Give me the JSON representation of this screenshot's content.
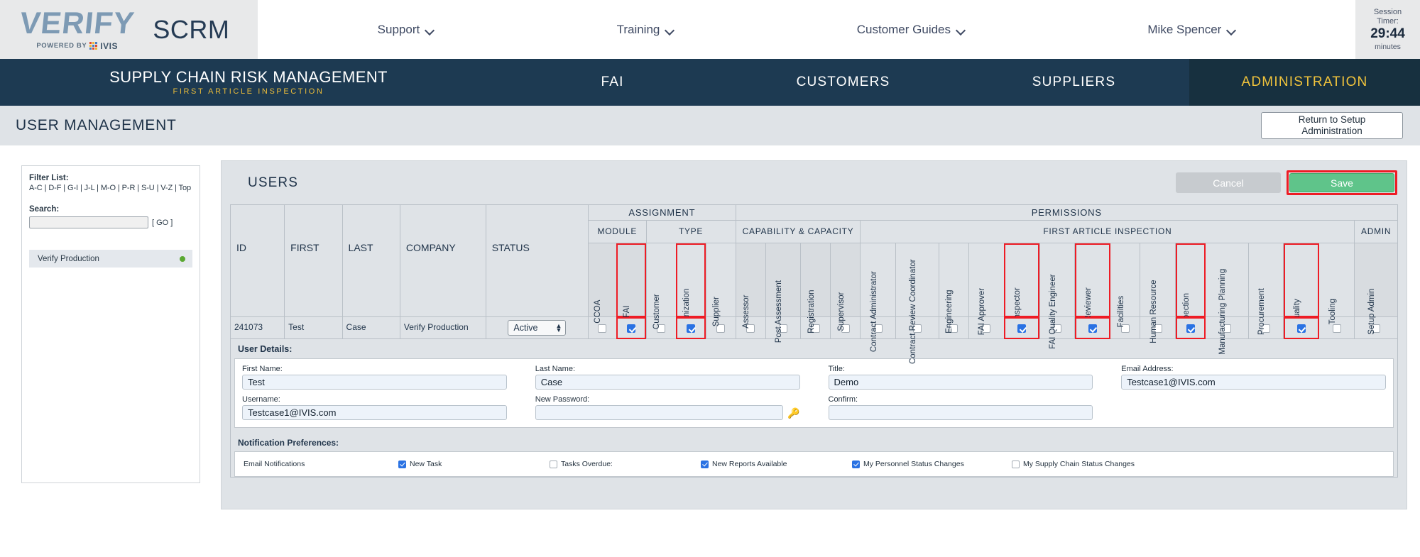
{
  "brand": {
    "logo_word": "VERIFY",
    "logo_powered": "POWERED BY",
    "logo_ivis": "IVIS",
    "product": "SCRM"
  },
  "topnav": {
    "items": [
      {
        "label": "Support",
        "icon": "chevron-down-icon"
      },
      {
        "label": "Training",
        "icon": "chevron-down-icon"
      },
      {
        "label": "Customer Guides",
        "icon": "chevron-down-icon"
      },
      {
        "label": "Mike Spencer",
        "icon": "chevron-down-icon"
      }
    ]
  },
  "session": {
    "line1": "Session",
    "line2": "Timer:",
    "time": "29:44",
    "unit": "minutes"
  },
  "appbar": {
    "title": "SUPPLY CHAIN RISK MANAGEMENT",
    "subtitle": "FIRST ARTICLE INSPECTION",
    "tabs": [
      {
        "label": "FAI",
        "active": false
      },
      {
        "label": "CUSTOMERS",
        "active": false
      },
      {
        "label": "SUPPLIERS",
        "active": false
      },
      {
        "label": "ADMINISTRATION",
        "active": true
      }
    ]
  },
  "titlebar": {
    "page_title": "USER MANAGEMENT",
    "return_line1": "Return to Setup",
    "return_line2": "Administration"
  },
  "sidebar": {
    "filter_label": "Filter List:",
    "alpha": "A-C | D-F | G-I | J-L | M-O | P-R | S-U | V-Z | Top",
    "search_label": "Search:",
    "search_value": "",
    "search_placeholder": "",
    "go_label": "[ GO ]",
    "items": [
      {
        "label": "Verify Production",
        "status_color": "#5aa832"
      }
    ]
  },
  "panel": {
    "title": "USERS",
    "cancel_label": "Cancel",
    "save_label": "Save"
  },
  "table": {
    "group_headers": [
      {
        "label": "ASSIGNMENT",
        "span": 5
      },
      {
        "label": "PERMISSIONS",
        "span": 18
      }
    ],
    "sub_headers": [
      {
        "label": "MODULE",
        "span": 2
      },
      {
        "label": "TYPE",
        "span": 3
      },
      {
        "label": "CAPABILITY & CAPACITY",
        "span": 4
      },
      {
        "label": "FIRST ARTICLE INSPECTION",
        "span": 13
      },
      {
        "label": "ADMIN",
        "span": 1
      }
    ],
    "text_columns": [
      "ID",
      "FIRST",
      "LAST",
      "COMPANY",
      "STATUS"
    ],
    "check_columns": [
      {
        "label": "CCOA",
        "highlight": false,
        "checked": false,
        "shade": true
      },
      {
        "label": "FAI",
        "highlight": true,
        "checked": true,
        "shade": true
      },
      {
        "label": "Customer",
        "highlight": false,
        "checked": false,
        "shade": false
      },
      {
        "label": "Organization",
        "highlight": true,
        "checked": true,
        "shade": false
      },
      {
        "label": "Supplier",
        "highlight": false,
        "checked": false,
        "shade": false
      },
      {
        "label": "Assessor",
        "highlight": false,
        "checked": false,
        "shade": true
      },
      {
        "label": "Post Assessment",
        "highlight": false,
        "checked": false,
        "shade": true
      },
      {
        "label": "Registration",
        "highlight": false,
        "checked": false,
        "shade": true
      },
      {
        "label": "Supervisor",
        "highlight": false,
        "checked": false,
        "shade": true
      },
      {
        "label": "Contract Administrator",
        "highlight": false,
        "checked": false,
        "shade": false
      },
      {
        "label": "Contract Review Coordinator",
        "highlight": false,
        "checked": false,
        "shade": false
      },
      {
        "label": "Engineering",
        "highlight": false,
        "checked": false,
        "shade": false
      },
      {
        "label": "FAI Approver",
        "highlight": false,
        "checked": false,
        "shade": false
      },
      {
        "label": "FAI Inspector",
        "highlight": true,
        "checked": true,
        "shade": false
      },
      {
        "label": "FAI Quality Engineer",
        "highlight": false,
        "checked": false,
        "shade": false
      },
      {
        "label": "FAI Reviewer",
        "highlight": true,
        "checked": true,
        "shade": false
      },
      {
        "label": "Facilities",
        "highlight": false,
        "checked": false,
        "shade": false
      },
      {
        "label": "Human Resource",
        "highlight": false,
        "checked": false,
        "shade": false
      },
      {
        "label": "Inspection",
        "highlight": true,
        "checked": true,
        "shade": false
      },
      {
        "label": "Manufacturing Planning",
        "highlight": false,
        "checked": false,
        "shade": false
      },
      {
        "label": "Procurement",
        "highlight": false,
        "checked": false,
        "shade": false
      },
      {
        "label": "Quality",
        "highlight": true,
        "checked": true,
        "shade": false
      },
      {
        "label": "Tooling",
        "highlight": false,
        "checked": false,
        "shade": false
      },
      {
        "label": "Setup Admin",
        "highlight": false,
        "checked": false,
        "shade": true
      }
    ],
    "row": {
      "id": "241073",
      "first": "Test",
      "last": "Case",
      "company": "Verify Production",
      "status": "Active"
    }
  },
  "details": {
    "section_title": "User Details:",
    "fields": [
      {
        "label": "First Name:",
        "value": "Test"
      },
      {
        "label": "Last Name:",
        "value": "Case"
      },
      {
        "label": "Title:",
        "value": "Demo"
      },
      {
        "label": "Email Address:",
        "value": "Testcase1@IVIS.com"
      },
      {
        "label": "Username:",
        "value": "Testcase1@IVIS.com"
      },
      {
        "label": "New Password:",
        "value": ""
      },
      {
        "label": "Confirm:",
        "value": ""
      }
    ]
  },
  "notifications": {
    "section_title": "Notification Preferences:",
    "row_label": "Email Notifications",
    "items": [
      {
        "label": "New Task",
        "checked": true
      },
      {
        "label": "Tasks Overdue:",
        "checked": false
      },
      {
        "label": "New Reports Available",
        "checked": true
      },
      {
        "label": "My Personnel Status Changes",
        "checked": true
      },
      {
        "label": "My Supply Chain Status Changes",
        "checked": false
      }
    ]
  },
  "colors": {
    "nav_dark": "#1d3a52",
    "accent_yellow": "#f0c33c",
    "save_green": "#5fc48a",
    "highlight_red": "#ee1c25",
    "status_green": "#5aa832",
    "checkbox_blue": "#2a72e3"
  }
}
